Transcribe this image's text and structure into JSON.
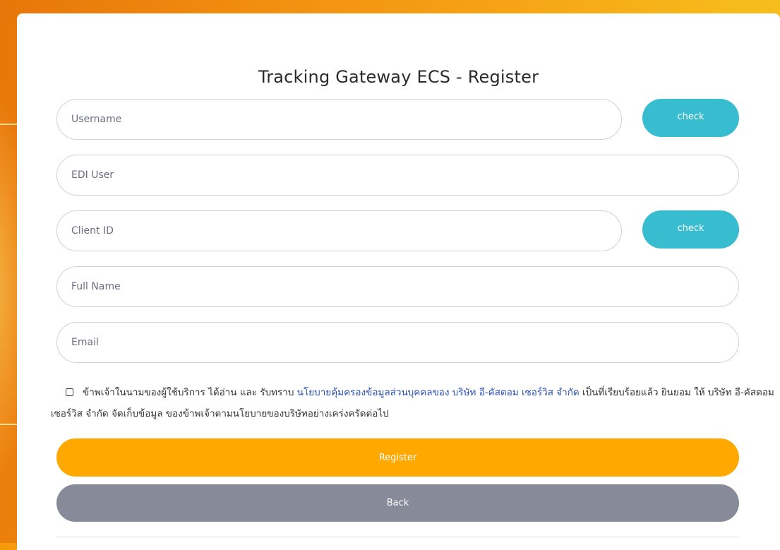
{
  "page": {
    "title": "Tracking Gateway ECS - Register"
  },
  "form": {
    "username_placeholder": "Username",
    "edi_user_placeholder": "EDI User",
    "client_id_placeholder": "Client ID",
    "full_name_placeholder": "Full Name",
    "email_placeholder": "Email",
    "username_check_label": "check",
    "client_id_check_label": "check"
  },
  "consent": {
    "checked": false,
    "text_before": "ข้าพเจ้าในนามของผู้ใช้บริการ ได้อ่าน และ รับทราบ ",
    "link_text": "นโยบายคุ้มครองข้อมูลส่วนบุคคลของ บริษัท อี-คัสตอม เซอร์วิส จำกัด",
    "text_after": " เป็นที่เรียบร้อยแล้ว ยินยอม ให้ บริษัท อี-คัสตอม เซอร์วิส จำกัด จัดเก็บข้อมูล ของข้าพเจ้าตามนโยบายของบริษัทอย่างเคร่งครัดต่อไป"
  },
  "actions": {
    "register_label": "Register",
    "back_label": "Back"
  },
  "colors": {
    "background": "#f59a0c",
    "check_button": "#38bcd0",
    "register_button": "#ffa800",
    "back_button": "#868a99",
    "link": "#2b4fb3"
  }
}
